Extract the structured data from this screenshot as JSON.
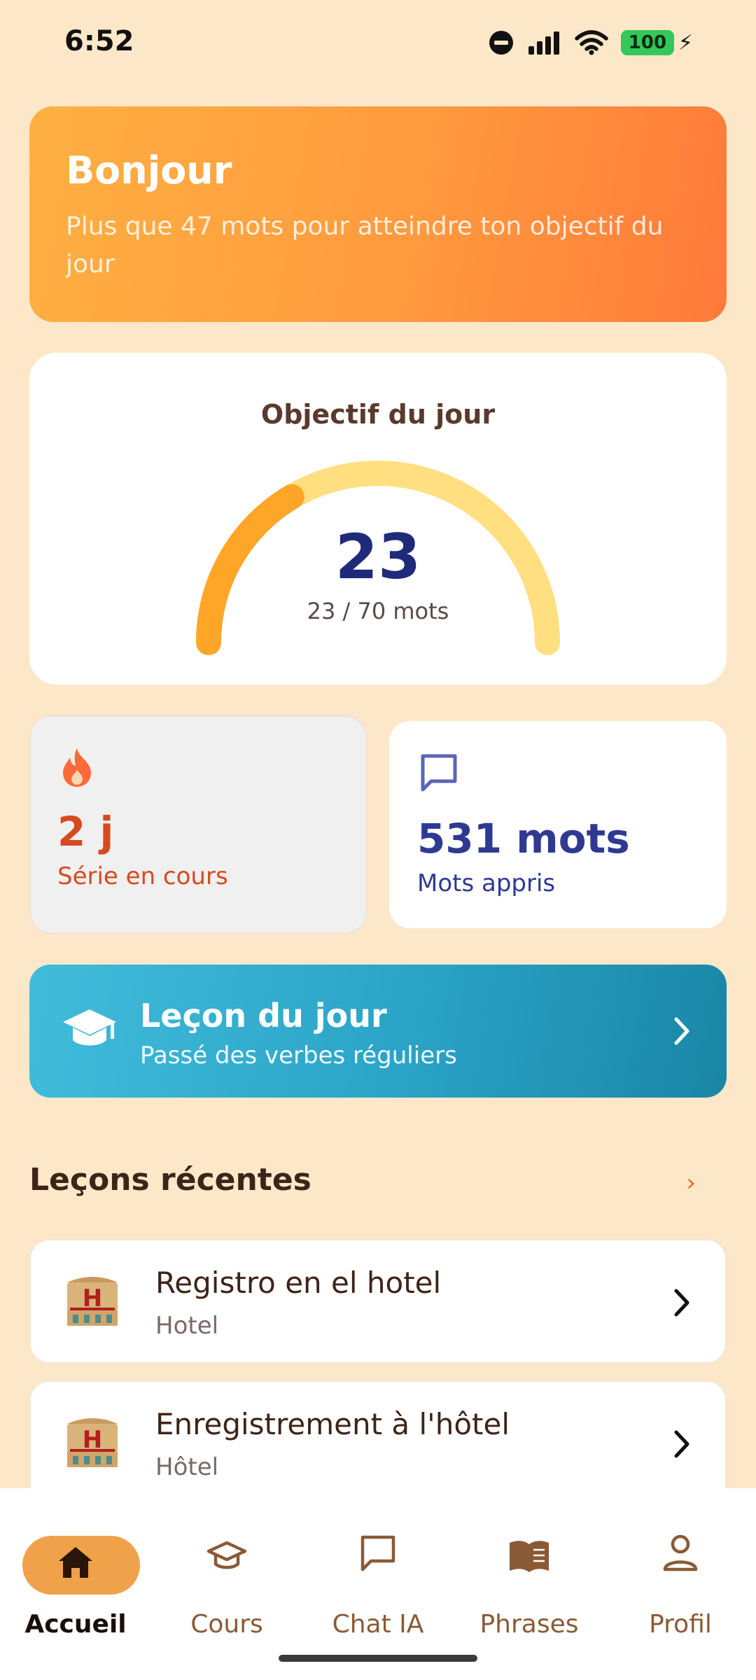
{
  "status_bar": {
    "time": "6:52",
    "battery": "100"
  },
  "greeting": {
    "title": "Bonjour",
    "subtitle": "Plus que 47 mots pour atteindre ton objectif du jour"
  },
  "daily_goal": {
    "title": "Objectif du jour",
    "value": "23",
    "progress_text": "23 / 70 mots",
    "progress": 0.33
  },
  "stats": {
    "streak": {
      "value": "2 j",
      "label": "Série en cours"
    },
    "words": {
      "value": "531 mots",
      "label": "Mots appris"
    }
  },
  "lesson_of_day": {
    "title": "Leçon du jour",
    "subtitle": "Passé des verbes réguliers"
  },
  "recent": {
    "title": "Leçons récentes",
    "more": "›",
    "items": [
      {
        "name": "Registro en el hotel",
        "category": "Hotel"
      },
      {
        "name": "Enregistrement à l'hôtel",
        "category": "Hôtel"
      }
    ]
  },
  "nav": [
    {
      "label": "Accueil",
      "icon": "home-icon"
    },
    {
      "label": "Cours",
      "icon": "graduation-cap-icon"
    },
    {
      "label": "Chat IA",
      "icon": "chat-icon"
    },
    {
      "label": "Phrases",
      "icon": "book-icon"
    },
    {
      "label": "Profil",
      "icon": "person-icon"
    }
  ],
  "colors": {
    "background": "#FCE7C9",
    "accent_orange": "#FF9A3E",
    "accent_blue": "#2AA3C6",
    "gauge_track": "#FFDF80",
    "gauge_fill": "#FFA628"
  }
}
